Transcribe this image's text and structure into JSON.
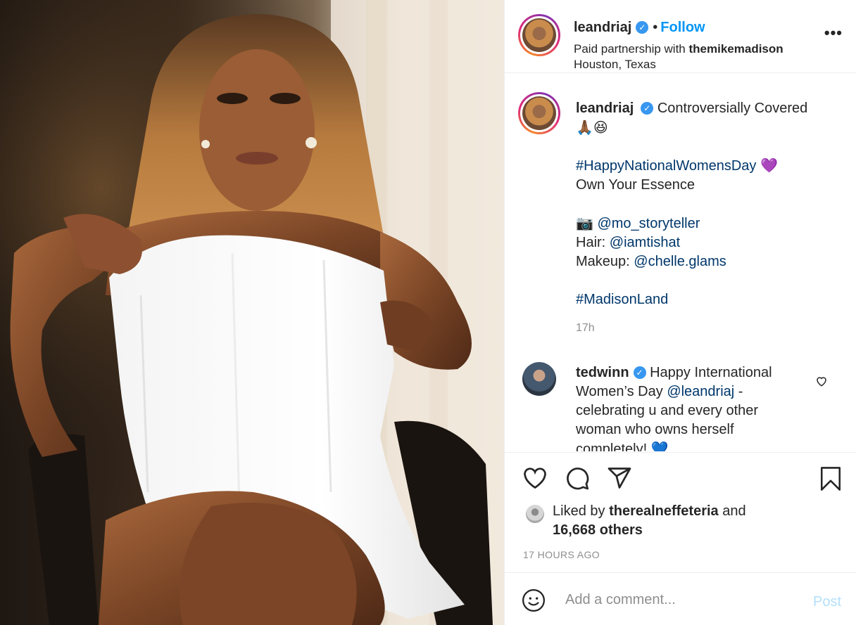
{
  "post": {
    "username": "leandriaj",
    "follow_label": "Follow",
    "dot": "•",
    "partnership_prefix": "Paid partnership with",
    "partner": "themikemadison",
    "location": "Houston, Texas",
    "more_label": "•••"
  },
  "caption": {
    "username": "leandriaj",
    "title": "Controversially Covered",
    "emojis1": "🙏🏾😆",
    "hashtag1": "#HappyNationalWomensDay",
    "emoji_heart": "💜",
    "line_essence": "Own Your Essence",
    "camera_emoji": "📷",
    "photographer": "@mo_storyteller",
    "hair_label": "Hair:",
    "hair_mention": "@iamtishat",
    "makeup_label": "Makeup:",
    "makeup_mention": "@chelle.glams",
    "hashtag2": "#MadisonLand",
    "time": "17h"
  },
  "comment": {
    "username": "tedwinn",
    "text_before": "Happy International Women’s Day",
    "mention": "@leandriaj",
    "text_after": "- celebrating u and every other woman who owns herself completely!",
    "emoji": "💙"
  },
  "likes": {
    "prefix": "Liked by",
    "user": "therealneffeteria",
    "and": "and",
    "count": "16,668 others"
  },
  "timestamp": "17 HOURS AGO",
  "add_comment": {
    "placeholder": "Add a comment...",
    "post_label": "Post"
  },
  "colors": {
    "link_blue": "#0095f6",
    "hashtag_blue": "#00376b",
    "verified_blue": "#3897f0",
    "muted": "#8e8e8e",
    "post_disabled": "#b2dffc"
  }
}
